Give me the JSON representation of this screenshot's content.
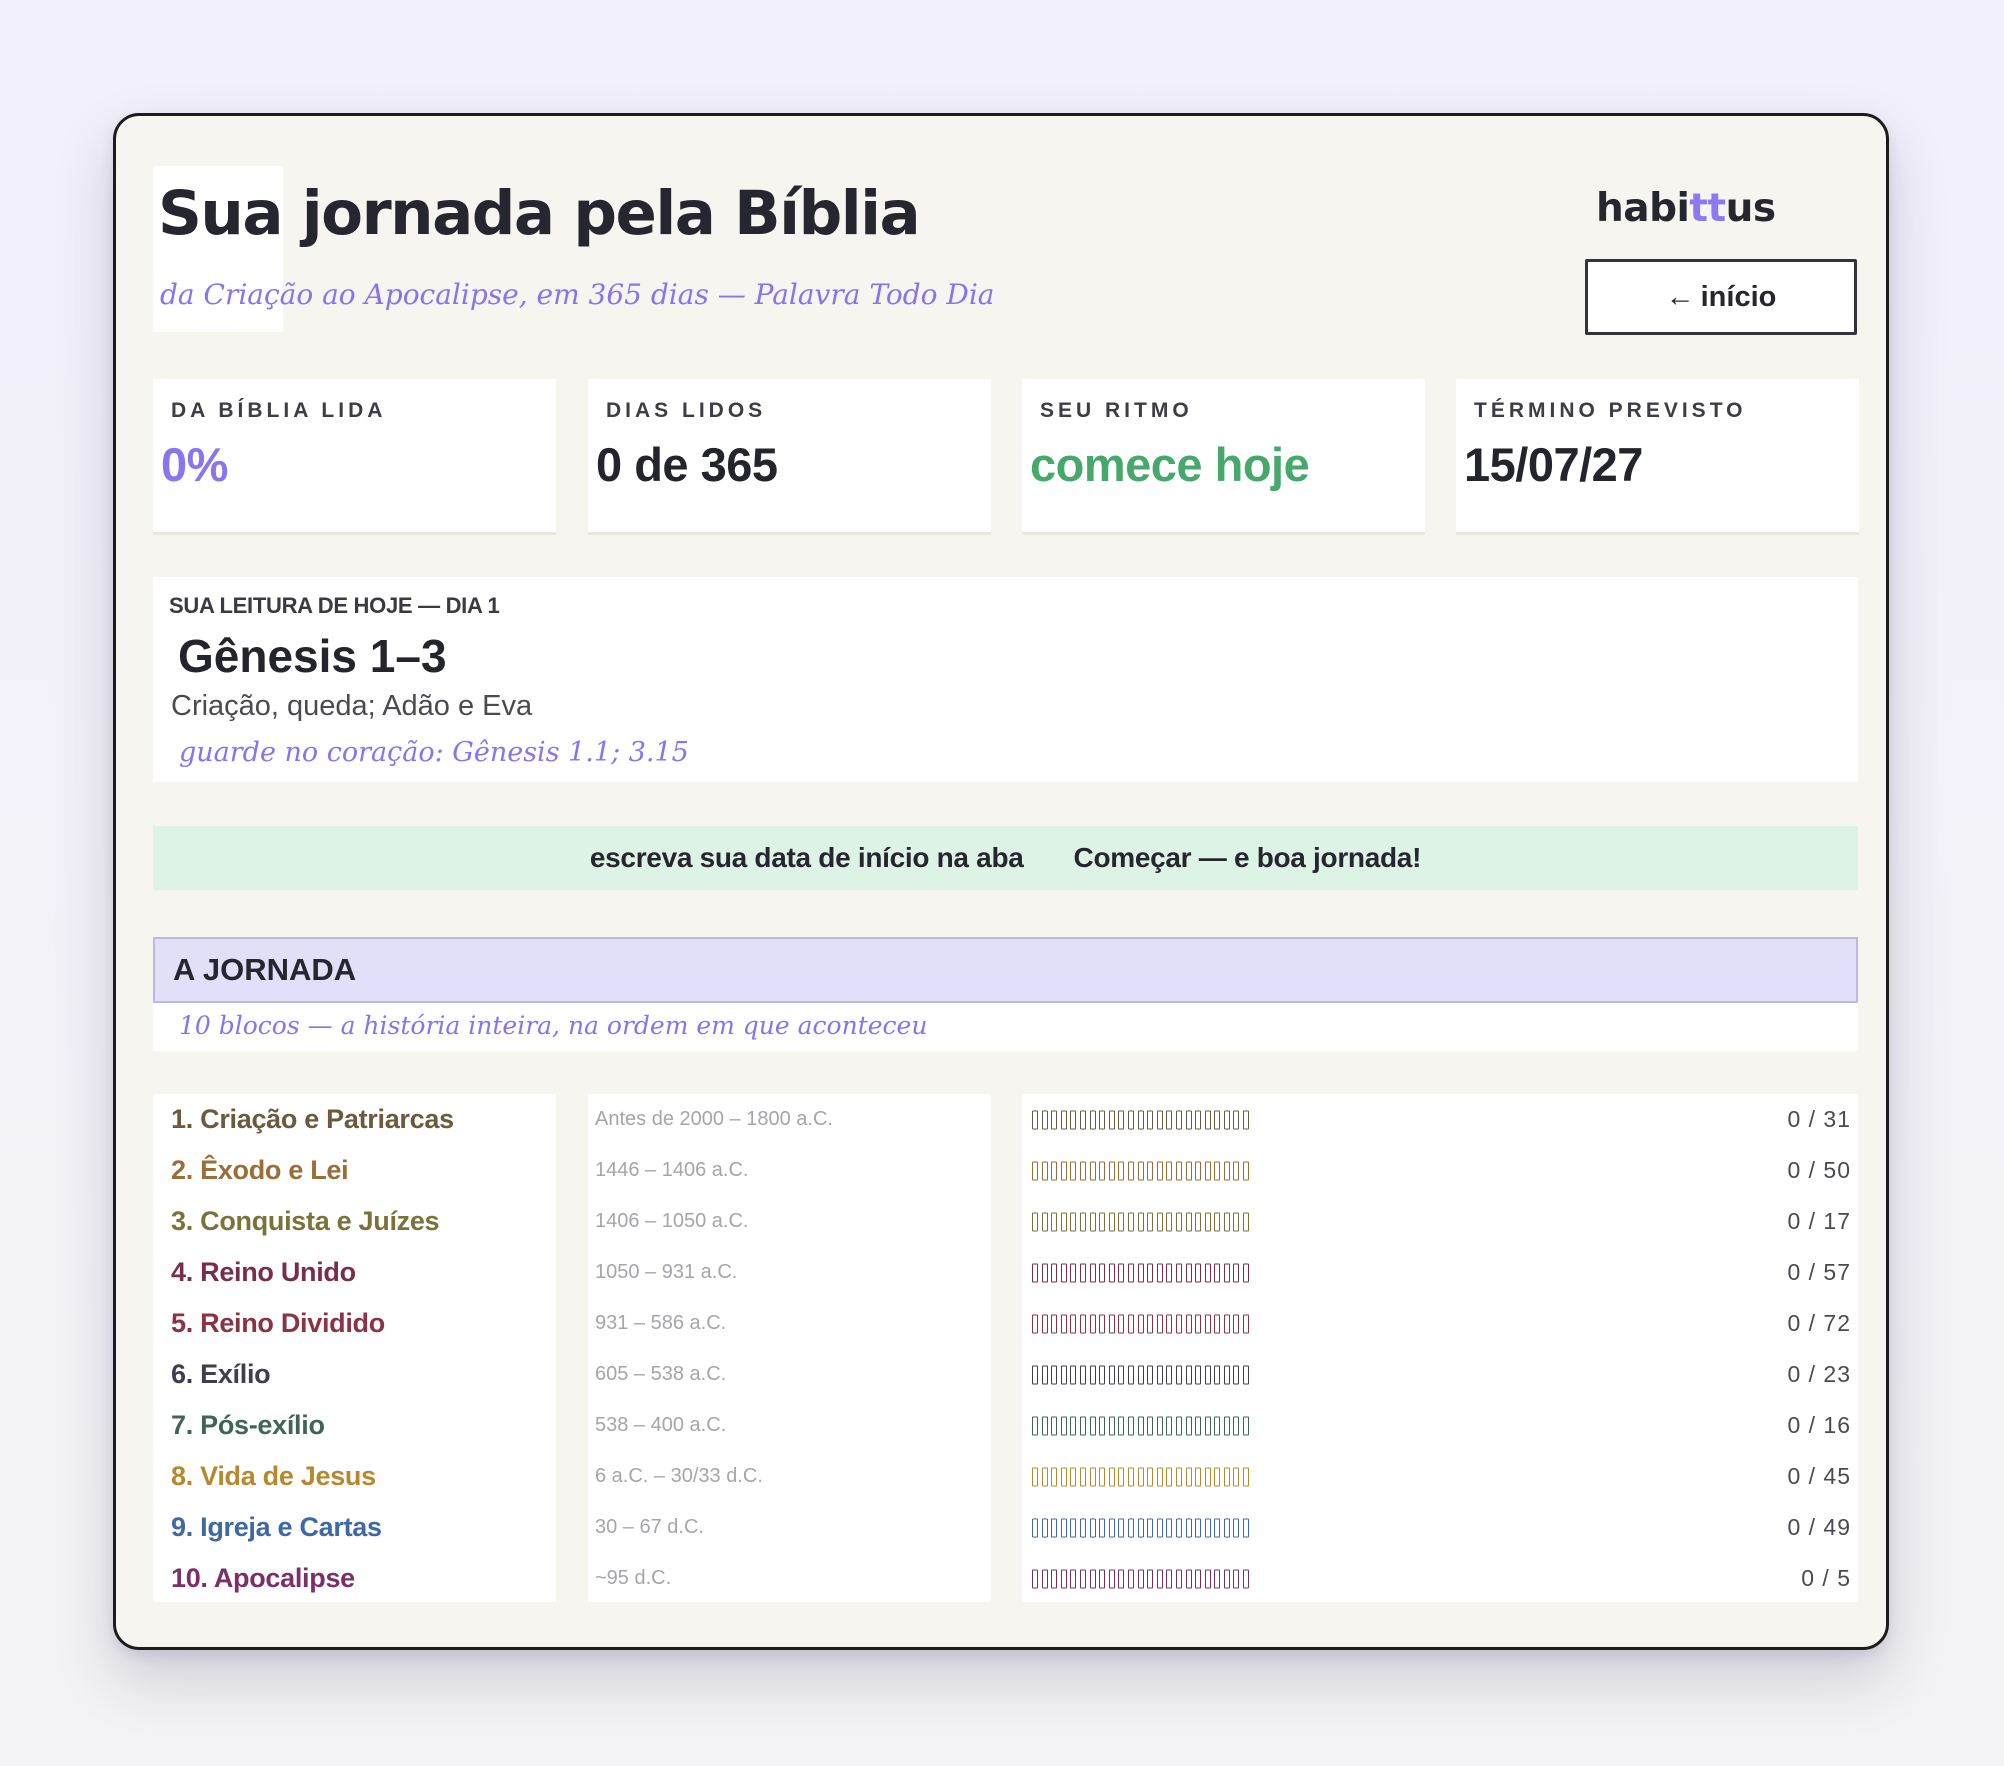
{
  "header": {
    "title": "Sua jornada pela Bíblia",
    "subtitle": "da Criação ao Apocalipse, em 365 dias — Palavra Todo Dia"
  },
  "brand": {
    "prefix": "habi",
    "accent": "tt",
    "suffix": "us"
  },
  "nav": {
    "home_arrow": "←",
    "home_label": "início"
  },
  "stats": [
    {
      "label": "DA BÍBLIA LIDA",
      "value": "0%",
      "color": "#8b74f0"
    },
    {
      "label": "DIAS LIDOS",
      "value": "0 de 365",
      "color": "#24242c"
    },
    {
      "label": "SEU RITMO",
      "value": "comece hoje",
      "color": "#46a86a"
    },
    {
      "label": "TÉRMINO PREVISTO",
      "value": "15/07/27",
      "color": "#24242c"
    }
  ],
  "today": {
    "label": "SUA LEITURA DE HOJE — DIA 1",
    "title": "Gênesis 1–3",
    "description": "Criação, queda; Adão e Eva",
    "memory": "guarde no coração: Gênesis 1.1; 3.15"
  },
  "banner": {
    "part1": "escreva sua data de início na aba",
    "part2": "Começar — e boa jornada!"
  },
  "journey": {
    "title": "A JORNADA",
    "subtitle": "10 blocos — a história inteira, na ordem em que aconteceu",
    "blocks": [
      {
        "name": "1. Criação e Patriarcas",
        "period": "Antes de 2000 – 1800 a.C.",
        "done": 0,
        "total": 31,
        "progress_text": "0 / 31",
        "color": "#6b5a3e"
      },
      {
        "name": "2. Êxodo e Lei",
        "period": "1446 – 1406 a.C.",
        "done": 0,
        "total": 50,
        "progress_text": "0 / 50",
        "color": "#9a6e37"
      },
      {
        "name": "3. Conquista e Juízes",
        "period": "1406 – 1050 a.C.",
        "done": 0,
        "total": 17,
        "progress_text": "0 / 17",
        "color": "#7a7238"
      },
      {
        "name": "4. Reino Unido",
        "period": "1050 – 931 a.C.",
        "done": 0,
        "total": 57,
        "progress_text": "0 / 57",
        "color": "#7a2d4a"
      },
      {
        "name": "5. Reino Dividido",
        "period": "931 – 586 a.C.",
        "done": 0,
        "total": 72,
        "progress_text": "0 / 72",
        "color": "#8a3346"
      },
      {
        "name": "6. Exílio",
        "period": "605 – 538 a.C.",
        "done": 0,
        "total": 23,
        "progress_text": "0 / 23",
        "color": "#3e3e50"
      },
      {
        "name": "7. Pós-exílio",
        "period": "538 – 400 a.C.",
        "done": 0,
        "total": 16,
        "progress_text": "0 / 16",
        "color": "#3f6458"
      },
      {
        "name": "8. Vida de Jesus",
        "period": "6 a.C. – 30/33 d.C.",
        "done": 0,
        "total": 45,
        "progress_text": "0 / 45",
        "color": "#b8892c"
      },
      {
        "name": "9. Igreja e Cartas",
        "period": "30 – 67 d.C.",
        "done": 0,
        "total": 49,
        "progress_text": "0 / 49",
        "color": "#3f68a8"
      },
      {
        "name": "10. Apocalipse",
        "period": "~95 d.C.",
        "done": 0,
        "total": 5,
        "progress_text": "0 / 5",
        "color": "#7a2f6a"
      }
    ]
  }
}
